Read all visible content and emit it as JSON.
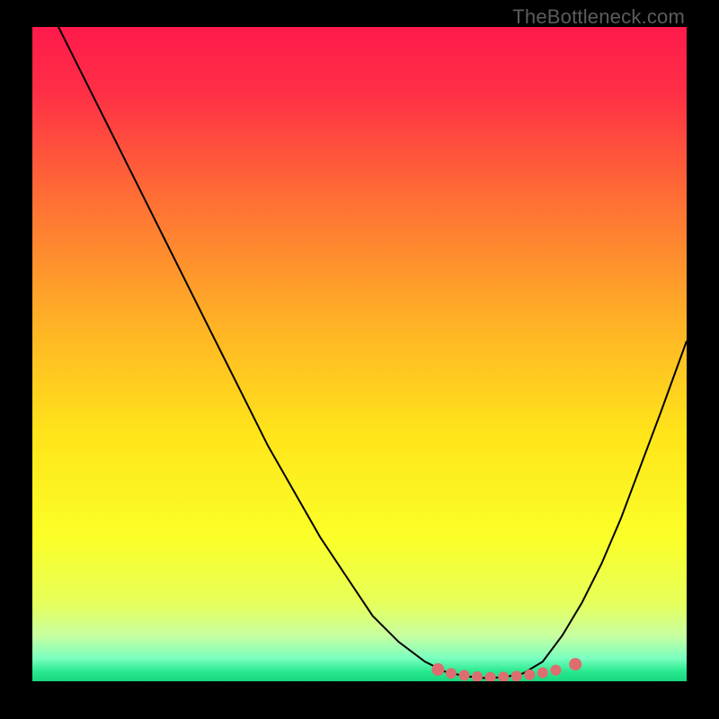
{
  "watermark": "TheBottleneck.com",
  "chart_data": {
    "type": "line",
    "title": "",
    "xlabel": "",
    "ylabel": "",
    "xlim": [
      0,
      100
    ],
    "ylim": [
      0,
      100
    ],
    "grid": false,
    "legend": false,
    "gradient_stops": [
      {
        "offset": 0.0,
        "color": "#ff1a4b"
      },
      {
        "offset": 0.1,
        "color": "#ff2f46"
      },
      {
        "offset": 0.25,
        "color": "#ff6a36"
      },
      {
        "offset": 0.45,
        "color": "#ffb126"
      },
      {
        "offset": 0.62,
        "color": "#ffe41a"
      },
      {
        "offset": 0.78,
        "color": "#fbff28"
      },
      {
        "offset": 0.88,
        "color": "#e7ff5a"
      },
      {
        "offset": 0.93,
        "color": "#c8ffa0"
      },
      {
        "offset": 0.965,
        "color": "#7affc0"
      },
      {
        "offset": 0.985,
        "color": "#28e98f"
      },
      {
        "offset": 1.0,
        "color": "#18d77e"
      }
    ],
    "series": [
      {
        "name": "bottleneck-curve",
        "stroke": "#000000",
        "x": [
          0,
          4,
          8,
          12,
          16,
          20,
          24,
          28,
          32,
          36,
          40,
          44,
          48,
          52,
          56,
          60,
          63,
          66,
          69,
          72,
          75,
          78,
          81,
          84,
          87,
          90,
          93,
          96,
          100
        ],
        "values": [
          108,
          100,
          92,
          84,
          76,
          68,
          60,
          52,
          44,
          36,
          29,
          22,
          16,
          10,
          6,
          3,
          1.5,
          0.8,
          0.5,
          0.6,
          1.2,
          3,
          7,
          12,
          18,
          25,
          33,
          41,
          52
        ]
      }
    ],
    "markers": {
      "name": "highlight-band",
      "color": "#de6d6f",
      "x": [
        62,
        64,
        66,
        68,
        70,
        72,
        74,
        76,
        78,
        80,
        83
      ],
      "values": [
        1.8,
        1.2,
        0.9,
        0.7,
        0.6,
        0.65,
        0.8,
        1.0,
        1.3,
        1.7,
        2.6
      ],
      "radius": [
        7,
        6,
        6,
        6,
        6,
        6,
        6,
        6,
        6,
        6,
        7
      ]
    }
  }
}
